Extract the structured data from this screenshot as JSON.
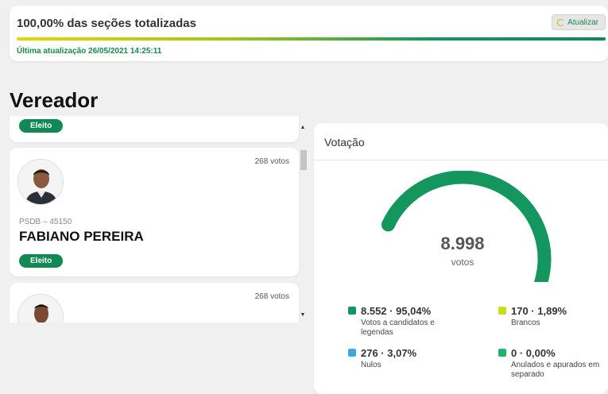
{
  "status": {
    "title": "100,00% das seções totalizadas",
    "refresh_label": "Atualizar",
    "progress_percent": 100,
    "updated": "Última atualização 26/05/2021 14:25:11"
  },
  "section_title": "Vereador",
  "candidates": [
    {
      "badge": "Eleito"
    },
    {
      "votes": "268 votos",
      "party": "PSDB – 45150",
      "name": "FABIANO PEREIRA",
      "badge": "Eleito"
    },
    {
      "votes": "268 votos"
    }
  ],
  "votacao": {
    "title": "Votação",
    "total": "8.998",
    "unit": "votos",
    "legend": [
      {
        "value": "8.552 · 95,04%",
        "label": "Votos a candidatos e legendas",
        "color": "#14975f",
        "fraction": 0.9504
      },
      {
        "value": "170 · 1,89%",
        "label": "Brancos",
        "color": "#c8e016",
        "fraction": 0.0189
      },
      {
        "value": "276 · 3,07%",
        "label": "Nulos",
        "color": "#36a9e1",
        "fraction": 0.0307
      },
      {
        "value": "0 · 0,00%",
        "label": "Anulados e apurados em separado",
        "color": "#1db36b",
        "fraction": 0
      }
    ]
  },
  "colors": {
    "accent": "#0f8a55",
    "update_text": "#178a4c"
  },
  "icons": {
    "refresh": "refresh-icon",
    "scroll_up": "scroll-up-arrow-icon",
    "scroll_down": "scroll-down-arrow-icon"
  }
}
